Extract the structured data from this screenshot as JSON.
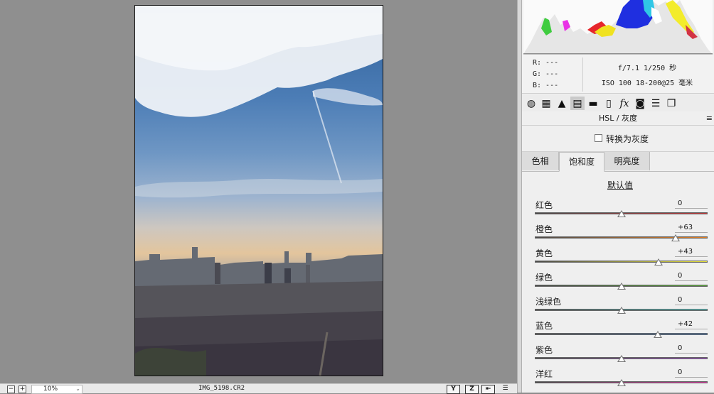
{
  "preview": {
    "zoom_minus": "−",
    "zoom_plus": "+",
    "zoom_value": "10%",
    "filename": "IMG_5198.CR2",
    "status_buttons": [
      "Y",
      "Z",
      "⇤",
      "☰"
    ]
  },
  "info": {
    "r": "R:  ---",
    "g": "G:  ---",
    "b": "B:  ---",
    "exposure": "f/7.1   1/250 秒",
    "iso_lens": "ISO 100   18-200@25 毫米"
  },
  "toolbar": {
    "icons": [
      "aperture-icon",
      "grid-icon",
      "tone-curve-icon",
      "hsl-icon",
      "split-toning-icon",
      "lens-icon",
      "fx-icon",
      "camera-icon",
      "presets-icon",
      "snapshots-icon"
    ]
  },
  "panel": {
    "title": "HSL / 灰度",
    "menu": "≡",
    "grayscale_label": "转换为灰度",
    "tabs": [
      "色相",
      "饱和度",
      "明亮度"
    ],
    "default_link": "默认值"
  },
  "sliders": [
    {
      "label": "红色",
      "value": "0",
      "level": 0,
      "color_a": "#4a4a4a",
      "color_b": "#c2383a"
    },
    {
      "label": "橙色",
      "value": "+63",
      "level": 63,
      "color_a": "#4a4a4a",
      "color_b": "#e07d22"
    },
    {
      "label": "黄色",
      "value": "+43",
      "level": 43,
      "color_a": "#4a4a4a",
      "color_b": "#e8e23a"
    },
    {
      "label": "绿色",
      "value": "0",
      "level": 0,
      "color_a": "#4a4a4a",
      "color_b": "#5db03c"
    },
    {
      "label": "浅绿色",
      "value": "0",
      "level": 0,
      "color_a": "#4a4a4a",
      "color_b": "#3fc4c2"
    },
    {
      "label": "蓝色",
      "value": "+42",
      "level": 42,
      "color_a": "#4a4a4a",
      "color_b": "#2f6fbf"
    },
    {
      "label": "紫色",
      "value": "0",
      "level": 0,
      "color_a": "#4a4a4a",
      "color_b": "#9848c0"
    },
    {
      "label": "洋红",
      "value": "0",
      "level": 0,
      "color_a": "#4a4a4a",
      "color_b": "#d0369a"
    }
  ]
}
